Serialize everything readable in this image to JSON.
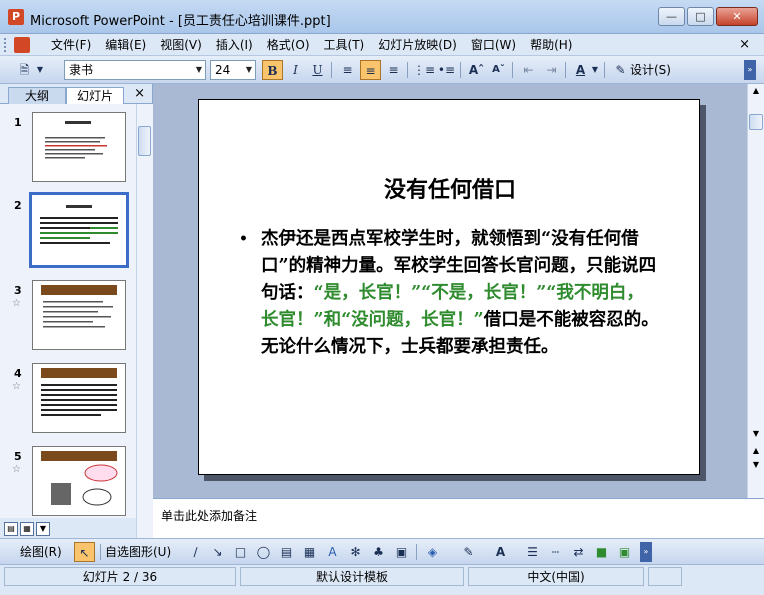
{
  "window": {
    "title": "Microsoft PowerPoint - [员工责任心培训课件.ppt]"
  },
  "menu": {
    "items": [
      "文件(F)",
      "编辑(E)",
      "视图(V)",
      "插入(I)",
      "格式(O)",
      "工具(T)",
      "幻灯片放映(D)",
      "窗口(W)",
      "帮助(H)"
    ],
    "close_doc": "×"
  },
  "toolbar": {
    "font_name": "隶书",
    "font_size": "24",
    "bold": "B",
    "italic": "I",
    "underline": "U",
    "font_color_letter": "A",
    "design_label": "设计(S)"
  },
  "left_pane": {
    "tabs": [
      "大纲",
      "幻灯片"
    ],
    "close": "×",
    "thumbnails": [
      {
        "num": "1",
        "starred": false
      },
      {
        "num": "2",
        "starred": false,
        "selected": true
      },
      {
        "num": "3",
        "starred": true
      },
      {
        "num": "4",
        "starred": true
      },
      {
        "num": "5",
        "starred": true
      }
    ],
    "star_glyph": "☆"
  },
  "slide": {
    "title": "没有任何借口",
    "bullet": "•",
    "body_black_1": "杰伊还是西点军校学生时，就领悟到“没有任何借口”的精神力量。军校学生回答长官问题，只能说四句话：",
    "body_green": "“是，长官！”“不是，长官！”“我不明白，长官！”和“没问题，长官！”",
    "body_black_2": "借口是不能被容忍的。无论什么情况下，士兵都要承担责任。"
  },
  "notes": {
    "placeholder": "单击此处添加备注"
  },
  "drawing_toolbar": {
    "draw_label": "绘图(R)",
    "autoshapes_label": "自选图形(U)"
  },
  "status": {
    "slide_info": "幻灯片 2 / 36",
    "template": "默认设计模板",
    "language": "中文(中国)"
  },
  "colors": {
    "green_text": "#2e8b2e",
    "selected_thumb": "#3a6cc8"
  }
}
